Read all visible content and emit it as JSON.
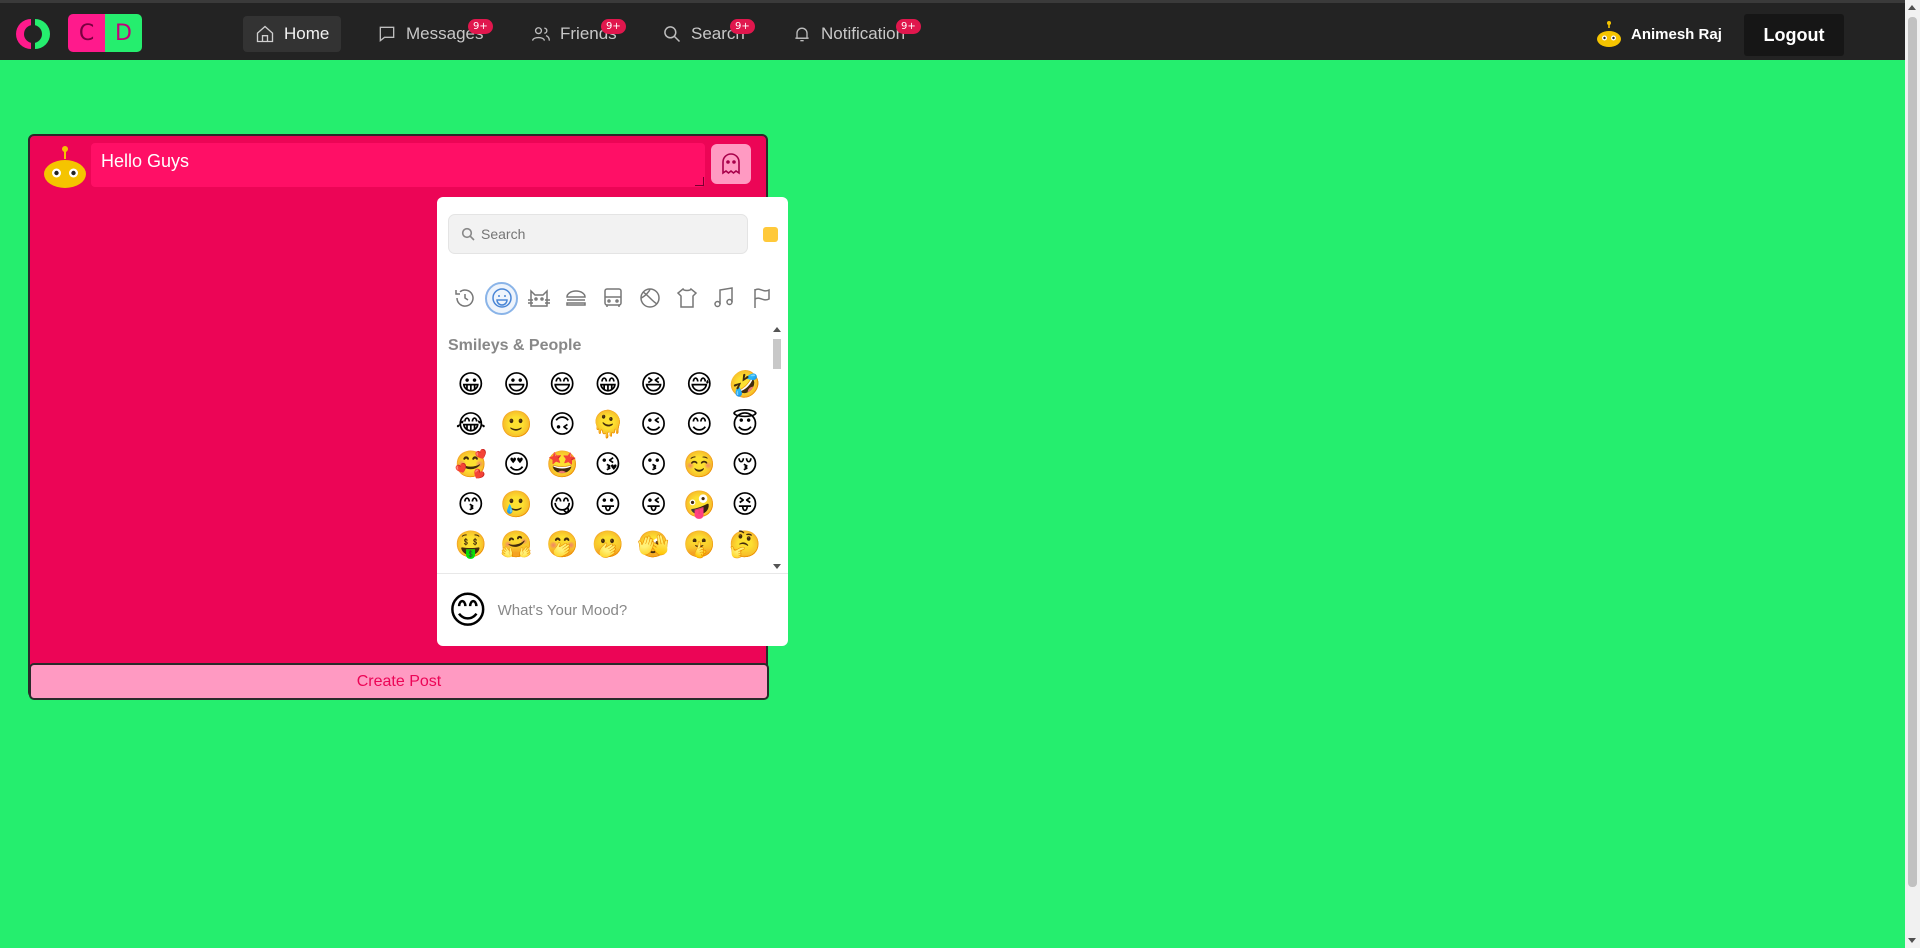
{
  "navbar": {
    "logo_text": [
      "C",
      "D"
    ],
    "items": [
      {
        "label": "Home",
        "icon": "home-icon",
        "badge": null,
        "active": true
      },
      {
        "label": "Messages",
        "icon": "chat-icon",
        "badge": "9+"
      },
      {
        "label": "Friends",
        "icon": "friends-icon",
        "badge": "9+"
      },
      {
        "label": "Search",
        "icon": "search-icon",
        "badge": "9+"
      },
      {
        "label": "Notification",
        "icon": "bell-icon",
        "badge": "9+"
      }
    ],
    "user_name": "Animesh Raj",
    "logout_label": "Logout"
  },
  "post": {
    "text": "Hello Guys",
    "create_label": "Create Post"
  },
  "emoji_picker": {
    "search_placeholder": "Search",
    "categories": [
      "recent-icon",
      "smileys-icon",
      "animals-icon",
      "food-icon",
      "travel-icon",
      "activities-icon",
      "objects-icon",
      "symbols-icon",
      "flags-icon"
    ],
    "group_title": "Smileys & People",
    "emojis": [
      "😀",
      "😃",
      "😄",
      "😁",
      "😆",
      "😅",
      "🤣",
      "😂",
      "🙂",
      "🙃",
      "🫠",
      "😉",
      "😊",
      "😇",
      "🥰",
      "😍",
      "🤩",
      "😘",
      "😗",
      "☺️",
      "😚",
      "😙",
      "🥲",
      "😋",
      "😛",
      "😜",
      "🤪",
      "😝",
      "🤑",
      "🤗",
      "🤭",
      "🫢",
      "🫣",
      "🤫",
      "🤔",
      "🫡",
      "🤐",
      "🤨",
      "😐",
      "😑",
      "😶",
      "🫥"
    ],
    "footer_emoji": "😊",
    "footer_text": "What's Your Mood?"
  },
  "colors": {
    "page_bg": "#25ee6e",
    "navbar_bg": "#232323",
    "card_bg": "#ec0556",
    "accent_pink": "#ff9ac2",
    "badge": "#e0174d"
  }
}
